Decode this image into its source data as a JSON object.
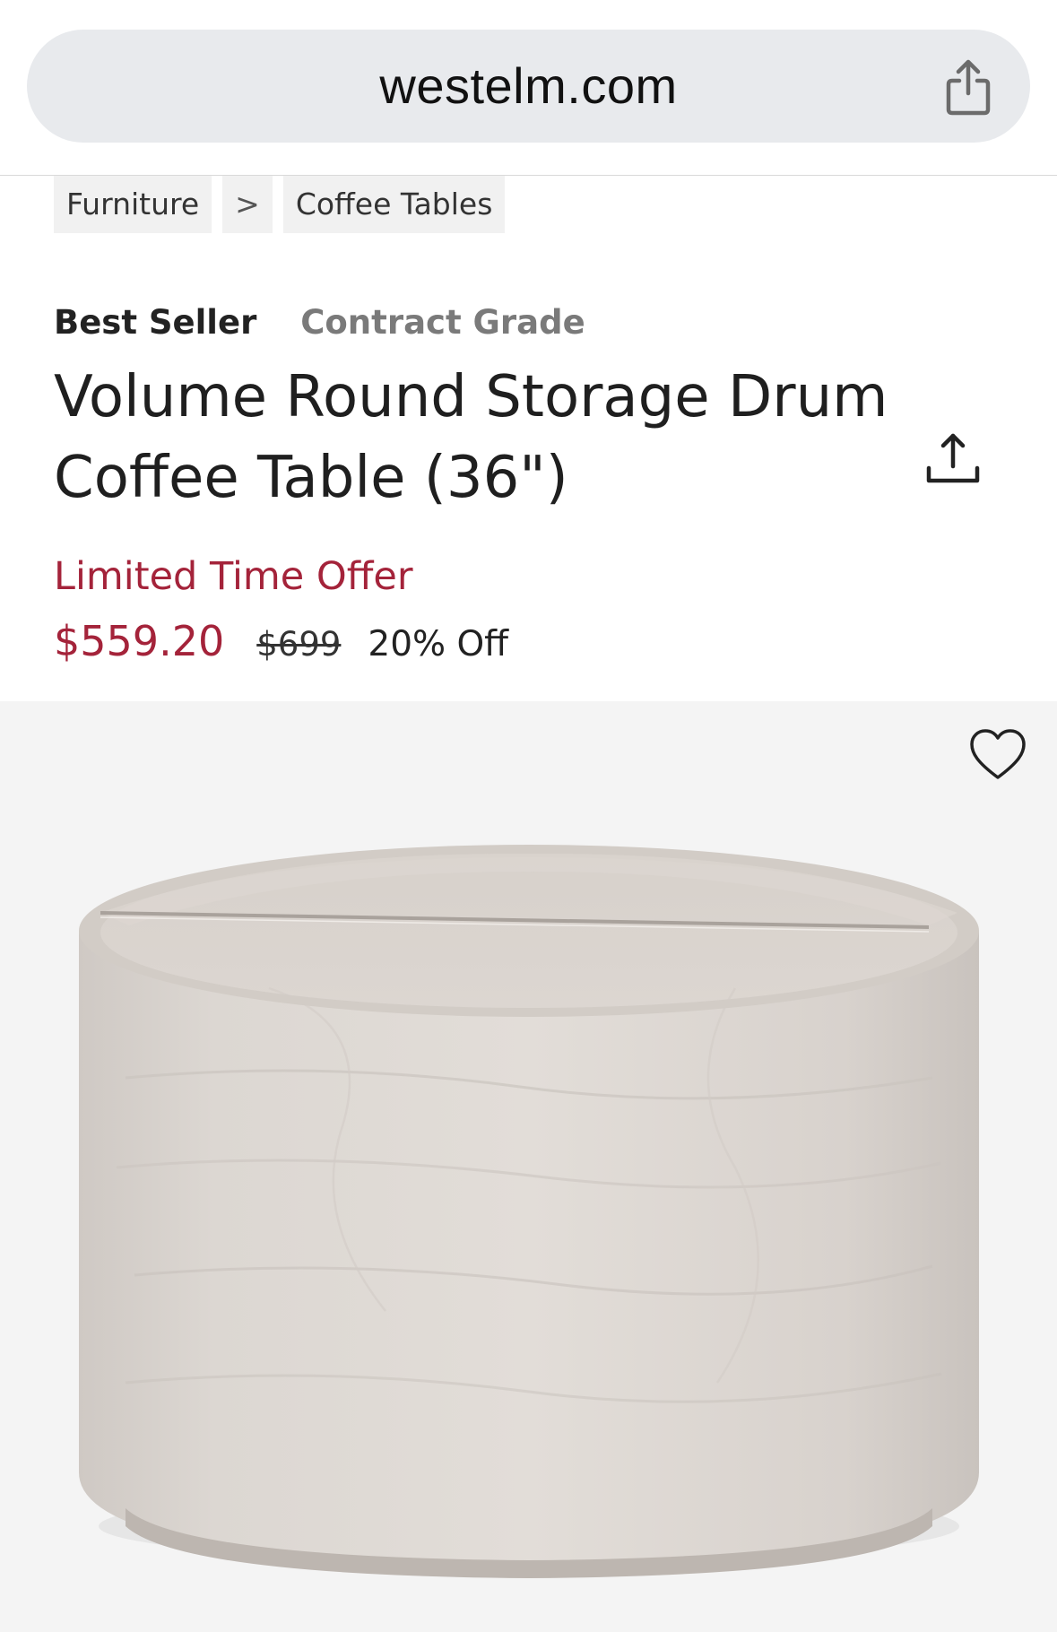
{
  "browser": {
    "url": "westelm.com",
    "share_icon": "share-icon"
  },
  "breadcrumb": {
    "items": [
      "Furniture",
      "Coffee Tables"
    ],
    "separator": ">"
  },
  "product": {
    "badges": {
      "best_seller": "Best Seller",
      "contract_grade": "Contract Grade"
    },
    "title_line1": "Volume Round Storage Drum",
    "title_line2": "Coffee Table (36\")",
    "offer_label": "Limited Time Offer",
    "sale_price": "$559.20",
    "original_price": "$699",
    "discount": "20% Off",
    "accent_color": "#a4233a"
  },
  "image": {
    "wishlist_icon": "heart-icon",
    "background": "#f4f4f4"
  }
}
